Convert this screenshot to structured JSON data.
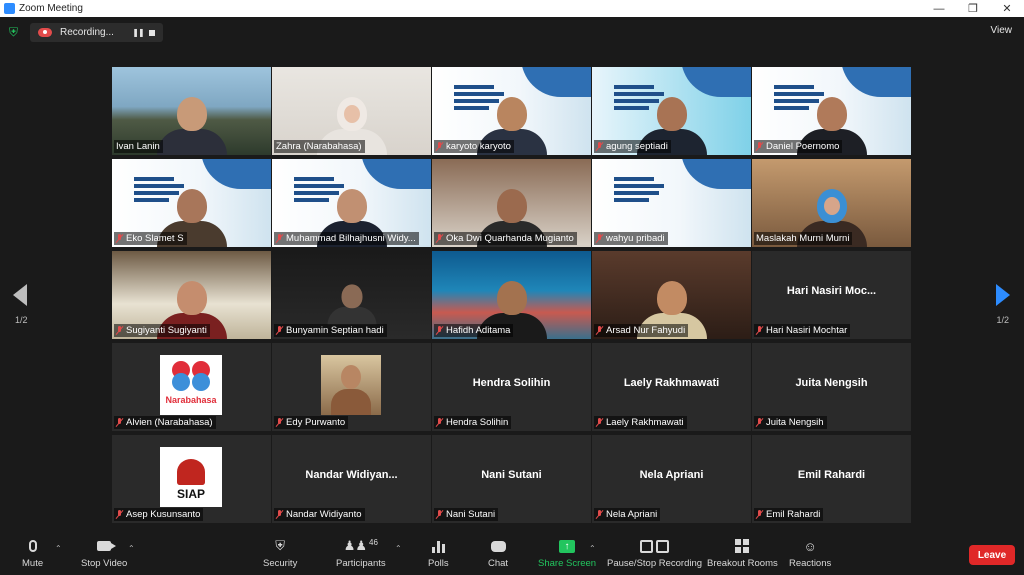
{
  "window": {
    "title": "Zoom Meeting"
  },
  "recording": {
    "label": "Recording..."
  },
  "view": {
    "label": "View"
  },
  "pagination": {
    "left": "1/2",
    "right": "1/2"
  },
  "tiles": [
    {
      "name": "Ivan Lanin",
      "type": "video",
      "muted": false
    },
    {
      "name": "Zahra (Narabahasa)",
      "type": "video",
      "muted": false,
      "active": true
    },
    {
      "name": "karyoto karyoto",
      "type": "video",
      "muted": true
    },
    {
      "name": "agung septiadi",
      "type": "video",
      "muted": true
    },
    {
      "name": "Daniel Poernomo",
      "type": "video",
      "muted": true
    },
    {
      "name": "Eko Slamet S",
      "type": "video",
      "muted": true
    },
    {
      "name": "Muhammad Bilhajhusni Widy...",
      "type": "video",
      "muted": true
    },
    {
      "name": "Oka Dwi Quarhanda Mugianto",
      "type": "video",
      "muted": true
    },
    {
      "name": "wahyu pribadi",
      "type": "video",
      "muted": true
    },
    {
      "name": "Maslakah Murni Murni",
      "type": "video",
      "muted": false
    },
    {
      "name": "Sugiyanti Sugiyanti",
      "type": "video",
      "muted": true
    },
    {
      "name": "Bunyamin Septian hadi",
      "type": "video",
      "muted": true
    },
    {
      "name": "Hafidh Aditama",
      "type": "video",
      "muted": true
    },
    {
      "name": "Arsad Nur Fahyudi",
      "type": "video",
      "muted": true
    },
    {
      "name": "Hari Nasiri Mochtar",
      "type": "name",
      "display": "Hari Nasiri Moc...",
      "muted": true
    },
    {
      "name": "Alvien (Narabahasa)",
      "type": "logo",
      "logo_text": "Narabahasa",
      "muted": true
    },
    {
      "name": "Edy Purwanto",
      "type": "photo",
      "muted": true
    },
    {
      "name": "Hendra Solihin",
      "type": "name",
      "display": "Hendra Solihin",
      "muted": true
    },
    {
      "name": "Laely Rakhmawati",
      "type": "name",
      "display": "Laely Rakhmawati",
      "muted": true
    },
    {
      "name": "Juita Nengsih",
      "type": "name",
      "display": "Juita Nengsih",
      "muted": true
    },
    {
      "name": "Asep Kusunsanto",
      "type": "siap",
      "logo_text": "SIAP",
      "muted": true
    },
    {
      "name": "Nandar Widiyanto",
      "type": "name",
      "display": "Nandar  Widiyan...",
      "muted": true
    },
    {
      "name": "Nani Sutani",
      "type": "name",
      "display": "Nani Sutani",
      "muted": true
    },
    {
      "name": "Nela Apriani",
      "type": "name",
      "display": "Nela Apriani",
      "muted": true
    },
    {
      "name": "Emil Rahardi",
      "type": "name",
      "display": "Emil Rahardi",
      "muted": true
    }
  ],
  "toolbar": {
    "mute": "Mute",
    "stop_video": "Stop Video",
    "security": "Security",
    "participants": "Participants",
    "participants_count": "46",
    "polls": "Polls",
    "chat": "Chat",
    "share_screen": "Share Screen",
    "pause_stop_recording": "Pause/Stop Recording",
    "breakout_rooms": "Breakout Rooms",
    "reactions": "Reactions",
    "leave": "Leave"
  },
  "colors": {
    "accent": "#2d8cff",
    "active_speaker": "#d7e83b",
    "share": "#22c55e",
    "leave": "#e02828",
    "muted": "#e24b4b"
  }
}
